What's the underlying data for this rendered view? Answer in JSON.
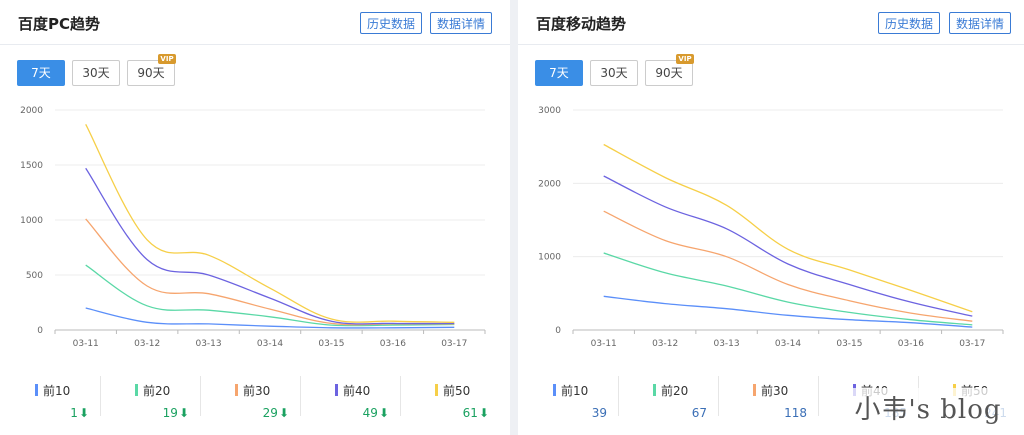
{
  "pc": {
    "title": "百度PC趋势",
    "history_label": "历史数据",
    "detail_label": "数据详情",
    "ranges": [
      "7天",
      "30天",
      "90天"
    ],
    "vip_badge": "VIP",
    "stats": [
      {
        "label": "前10",
        "value": "1",
        "trend": "down"
      },
      {
        "label": "前20",
        "value": "19",
        "trend": "down"
      },
      {
        "label": "前30",
        "value": "29",
        "trend": "down"
      },
      {
        "label": "前40",
        "value": "49",
        "trend": "down"
      },
      {
        "label": "前50",
        "value": "61",
        "trend": "down"
      }
    ]
  },
  "mobile": {
    "title": "百度移动趋势",
    "history_label": "历史数据",
    "detail_label": "数据详情",
    "ranges": [
      "7天",
      "30天",
      "90天"
    ],
    "vip_badge": "VIP",
    "stats": [
      {
        "label": "前10",
        "value": "39"
      },
      {
        "label": "前20",
        "value": "67"
      },
      {
        "label": "前30",
        "value": "118"
      },
      {
        "label": "前40",
        "value": "185"
      },
      {
        "label": "前50",
        "value": "241"
      }
    ]
  },
  "colors": {
    "前10": "#5b8ff9",
    "前20": "#5ad8a6",
    "前30": "#f6a56e",
    "前40": "#6c63e0",
    "前50": "#f6cf48",
    "accent": "#3a8ee6",
    "down": "#1aa160"
  },
  "watermark": "小韦's blog",
  "chart_data": [
    {
      "type": "line",
      "title": "百度PC趋势",
      "x": [
        "03-11",
        "03-12",
        "03-13",
        "03-14",
        "03-15",
        "03-16",
        "03-17"
      ],
      "ylim": [
        0,
        2000
      ],
      "yticks": [
        0,
        500,
        1000,
        1500,
        2000
      ],
      "grid": true,
      "series": [
        {
          "name": "前10",
          "values": [
            200,
            70,
            55,
            35,
            20,
            20,
            25
          ]
        },
        {
          "name": "前20",
          "values": [
            590,
            220,
            180,
            120,
            45,
            45,
            50
          ]
        },
        {
          "name": "前30",
          "values": [
            1010,
            400,
            330,
            190,
            60,
            55,
            55
          ]
        },
        {
          "name": "前40",
          "values": [
            1470,
            640,
            500,
            290,
            80,
            60,
            60
          ]
        },
        {
          "name": "前50",
          "values": [
            1870,
            820,
            680,
            380,
            100,
            80,
            70
          ]
        }
      ]
    },
    {
      "type": "line",
      "title": "百度移动趋势",
      "x": [
        "03-11",
        "03-12",
        "03-13",
        "03-14",
        "03-15",
        "03-16",
        "03-17"
      ],
      "ylim": [
        0,
        3000
      ],
      "yticks": [
        0,
        1000,
        2000,
        3000
      ],
      "grid": true,
      "series": [
        {
          "name": "前10",
          "values": [
            460,
            360,
            290,
            200,
            140,
            100,
            40
          ]
        },
        {
          "name": "前20",
          "values": [
            1050,
            780,
            600,
            380,
            240,
            140,
            70
          ]
        },
        {
          "name": "前30",
          "values": [
            1620,
            1220,
            1000,
            620,
            400,
            230,
            120
          ]
        },
        {
          "name": "前40",
          "values": [
            2100,
            1680,
            1380,
            900,
            620,
            380,
            190
          ]
        },
        {
          "name": "前50",
          "values": [
            2530,
            2080,
            1700,
            1100,
            820,
            540,
            250
          ]
        }
      ]
    }
  ]
}
